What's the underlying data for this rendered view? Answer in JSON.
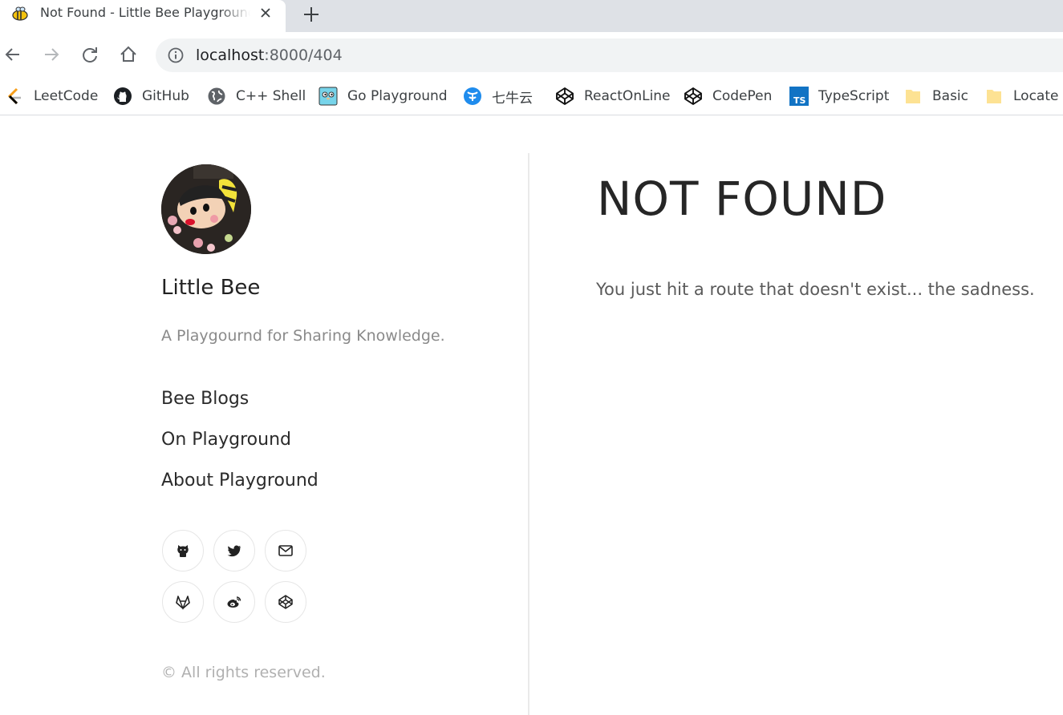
{
  "browser": {
    "tab": {
      "title": "Not Found - Little Bee Playground",
      "close_label": "×"
    },
    "new_tab_label": "+",
    "address": {
      "host": "localhost",
      "rest": ":8000/404"
    },
    "bookmarks": [
      {
        "label": "LeetCode",
        "icon": "leetcode-icon"
      },
      {
        "label": "GitHub",
        "icon": "github-icon"
      },
      {
        "label": "C++ Shell",
        "icon": "globe-icon"
      },
      {
        "label": "Go Playground",
        "icon": "gopher-icon"
      },
      {
        "label": "七牛云",
        "icon": "qiniu-icon"
      },
      {
        "label": "ReactOnLine",
        "icon": "codepen-icon"
      },
      {
        "label": "CodePen",
        "icon": "codepen-icon"
      },
      {
        "label": "TypeScript",
        "icon": "typescript-icon"
      },
      {
        "label": "Basic",
        "icon": "folder-icon"
      },
      {
        "label": "Locate",
        "icon": "folder-icon"
      }
    ]
  },
  "sidebar": {
    "title": "Little Bee",
    "description": "A Playgournd for Sharing Knowledge.",
    "nav": [
      {
        "label": "Bee Blogs"
      },
      {
        "label": "On Playground"
      },
      {
        "label": "About Playground"
      }
    ],
    "social": [
      {
        "icon": "github-icon"
      },
      {
        "icon": "twitter-icon"
      },
      {
        "icon": "email-icon"
      },
      {
        "icon": "gitlab-icon"
      },
      {
        "icon": "weibo-icon"
      },
      {
        "icon": "codepen-icon"
      }
    ],
    "copyright": "© All rights reserved."
  },
  "content": {
    "heading": "NOT FOUND",
    "message": "You just hit a route that doesn't exist... the sadness."
  },
  "colors": {
    "tabstrip": "#dee1e6",
    "omnibox": "#f1f3f4",
    "divider": "#eaeaea",
    "heading": "#262626",
    "muted": "#8a8a8a"
  }
}
